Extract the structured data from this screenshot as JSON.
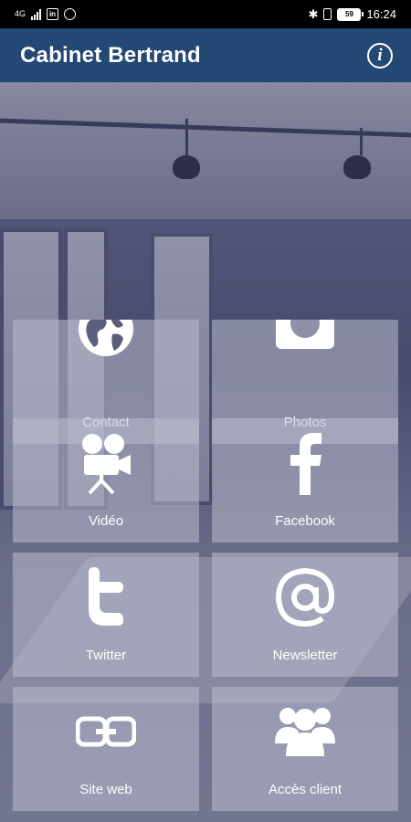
{
  "status_bar": {
    "network": "4G",
    "linkedin_badge": "in",
    "battery": "59",
    "time": "16:24"
  },
  "app_bar": {
    "title": "Cabinet Bertrand",
    "info_icon": "info-icon"
  },
  "tiles": [
    {
      "label": "Contact",
      "icon": "globe-icon"
    },
    {
      "label": "Photos",
      "icon": "camera-icon"
    },
    {
      "label": "Vidéo",
      "icon": "video-camera-icon"
    },
    {
      "label": "Facebook",
      "icon": "facebook-icon"
    },
    {
      "label": "Twitter",
      "icon": "twitter-icon"
    },
    {
      "label": "Newsletter",
      "icon": "at-sign-icon"
    },
    {
      "label": "Site web",
      "icon": "link-icon"
    },
    {
      "label": "Accès client",
      "icon": "users-icon"
    }
  ],
  "colors": {
    "app_bar": "#234873",
    "status_bar": "#000000",
    "tile_overlay": "#babcce"
  }
}
